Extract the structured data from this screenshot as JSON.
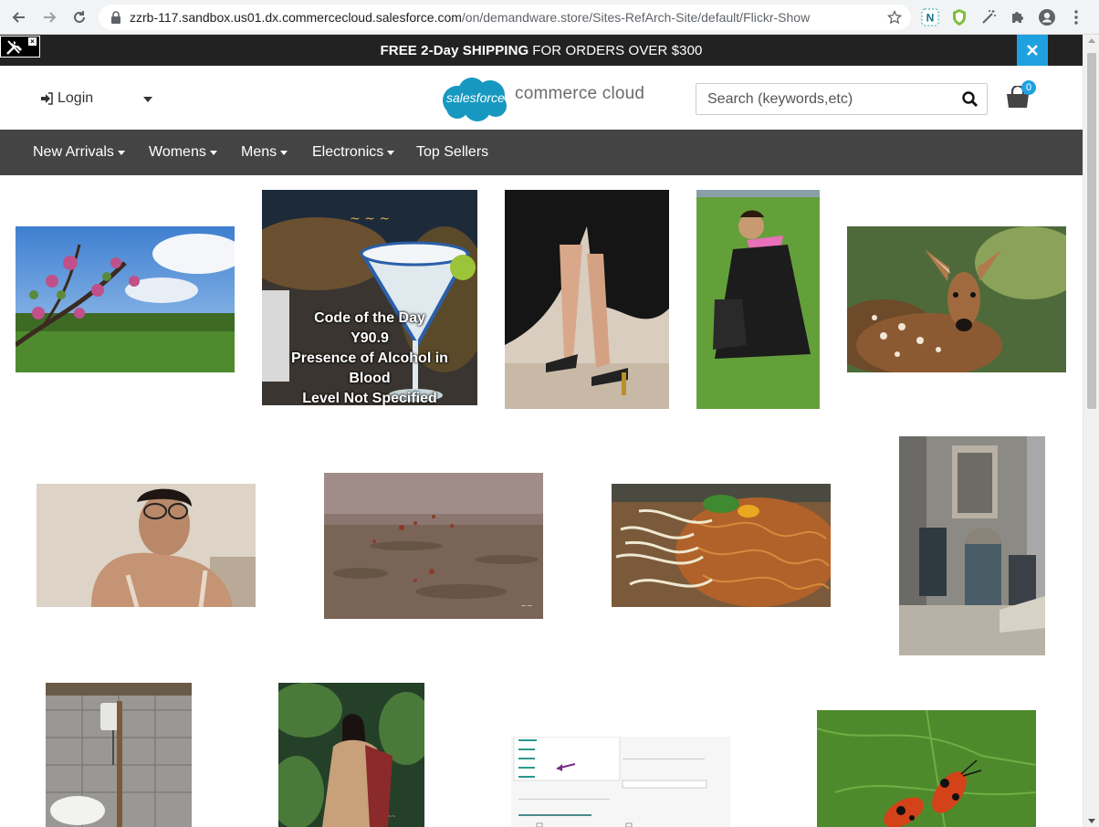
{
  "browser": {
    "url_host": "zzrb-117.sandbox.us01.dx.commercecloud.salesforce.com",
    "url_path": "/on/demandware.store/Sites-RefArch-Site/default/Flickr-Show",
    "extension_badge": "N"
  },
  "promo": {
    "bold_text": "FREE 2-Day SHIPPING",
    "text": "FOR ORDERS OVER $300"
  },
  "header": {
    "login_label": "Login",
    "logo_badge_text": "salesforce",
    "logo_text": "commerce cloud",
    "search_placeholder": "Search (keywords,etc)",
    "cart_count": "0"
  },
  "nav": {
    "items": [
      "New Arrivals",
      "Womens",
      "Mens",
      "Electronics",
      "Top Sellers"
    ]
  },
  "gallery": {
    "cocktail_overlay": [
      "Code of the Day",
      "Y90.9",
      "Presence of Alcohol in",
      "Blood",
      "Level Not Specified"
    ]
  },
  "colors": {
    "accent": "#1fa1e0",
    "promo_bg": "#222222",
    "nav_bg": "#444444"
  }
}
